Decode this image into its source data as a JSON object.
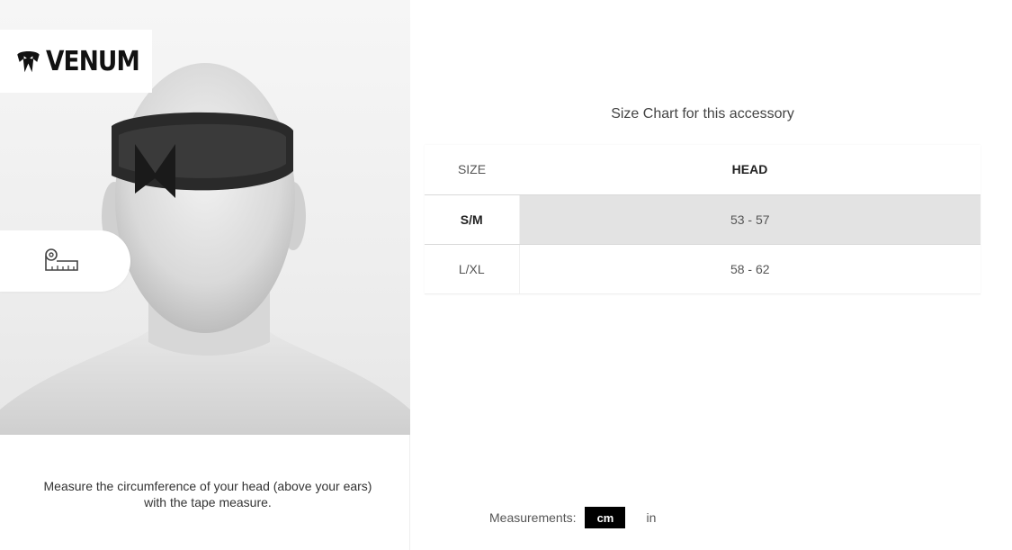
{
  "brand": {
    "name": "VENUM"
  },
  "illustration": {
    "subject": "mannequin-head-with-measuring-band"
  },
  "icons": {
    "tape": "tape-measure-icon",
    "logo": "venum-snake-icon"
  },
  "instructions": "Measure the circumference of your head (above your ears) with the tape measure.",
  "chart": {
    "title": "Size Chart for this accessory",
    "columns": [
      "SIZE",
      "HEAD"
    ],
    "rows": [
      {
        "size": "S/M",
        "head": "53 - 57",
        "selected": true
      },
      {
        "size": "L/XL",
        "head": "58 - 62",
        "selected": false
      }
    ]
  },
  "units": {
    "label": "Measurements:",
    "options": [
      "cm",
      "in"
    ],
    "selected": "cm"
  },
  "colors": {
    "selected_row": "#e3e3e3",
    "unit_active_bg": "#000000",
    "text": "#444444"
  }
}
